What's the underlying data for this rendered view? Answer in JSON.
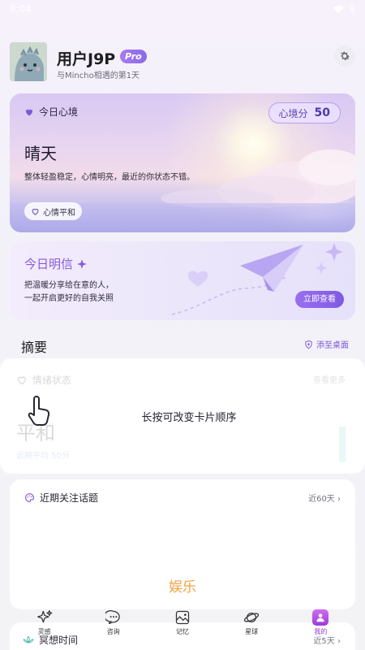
{
  "status_bar": {
    "time": "9:04",
    "battery": "9"
  },
  "header": {
    "user_name": "用户J9P",
    "pro_badge": "Pro",
    "subtitle": "与Mincho相遇的第1天"
  },
  "mood_card": {
    "label": "今日心境",
    "score_label": "心境分",
    "score_value": "50",
    "weather": "晴天",
    "description": "整体轻盈稳定，心情明亮，最近的你状态不错。",
    "tag": "心情平和"
  },
  "letter_card": {
    "title": "今日明信",
    "desc_line1": "把温暖分享给在意的人，",
    "desc_line2": "一起开启更好的自我关照",
    "button": "立即查看"
  },
  "summary": {
    "title": "摘要",
    "add_to_desktop": "添至桌面"
  },
  "emotion_card": {
    "title": "情绪状态",
    "more": "查看更多",
    "value": "平和",
    "sub": "近期平均 50分",
    "hint": "长按可改变卡片顺序"
  },
  "topics_card": {
    "title": "近期关注话题",
    "range": "近60天",
    "item": "娱乐"
  },
  "meditation_card": {
    "title": "冥想时间",
    "range": "近5天"
  },
  "bottom_nav": [
    {
      "label": "灵感",
      "icon": "sparkle-icon"
    },
    {
      "label": "咨询",
      "icon": "chat-icon"
    },
    {
      "label": "记忆",
      "icon": "photo-icon"
    },
    {
      "label": "星球",
      "icon": "planet-icon"
    },
    {
      "label": "我的",
      "icon": "profile-icon"
    }
  ],
  "colors": {
    "accent": "#8759dc",
    "topic_orange": "#f2a33e",
    "nav_active": "#9b3ad8"
  }
}
